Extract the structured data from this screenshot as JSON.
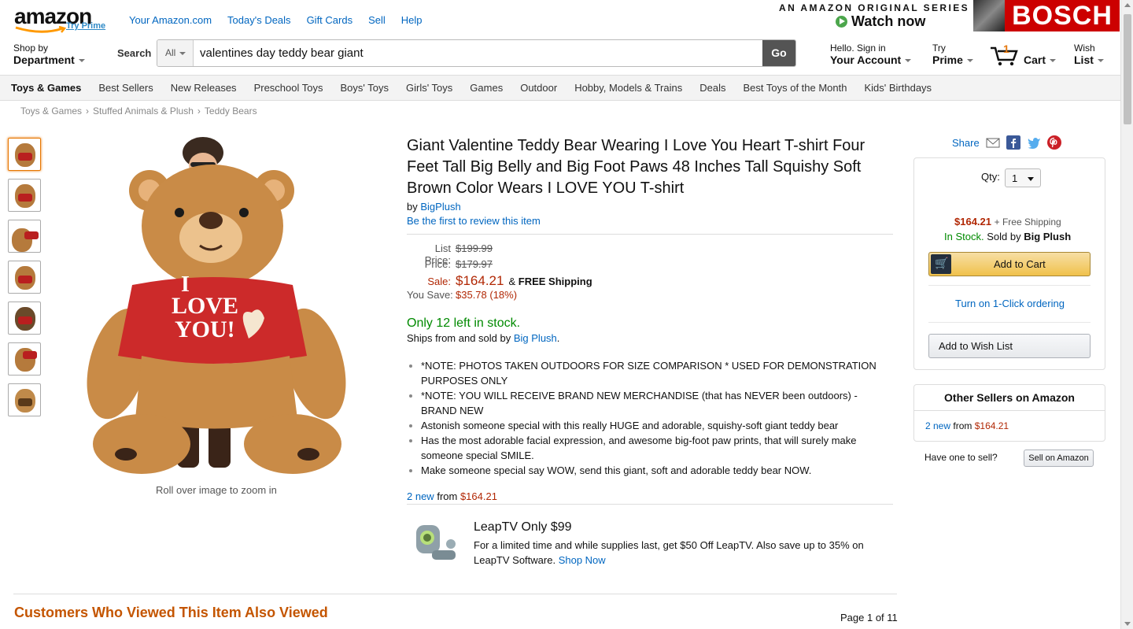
{
  "header": {
    "logo_text": "amazon",
    "try_prime": "Try Prime",
    "top_links": [
      "Your Amazon.com",
      "Today's Deals",
      "Gift Cards",
      "Sell",
      "Help"
    ],
    "promo": {
      "line1": "AN AMAZON ORIGINAL SERIES",
      "watch": "Watch now",
      "brand": "BOSCH"
    },
    "shop_by": {
      "small": "Shop by",
      "bold": "Department"
    },
    "search": {
      "label": "Search",
      "category": "All",
      "value": "valentines day teddy bear giant",
      "go": "Go"
    },
    "account": {
      "small": "Hello. Sign in",
      "bold": "Your Account"
    },
    "prime": {
      "small": "Try",
      "bold": "Prime"
    },
    "cart": {
      "count": "1",
      "label": "Cart"
    },
    "wish": {
      "small": "Wish",
      "bold": "List"
    }
  },
  "category_bar": [
    "Toys & Games",
    "Best Sellers",
    "New Releases",
    "Preschool Toys",
    "Boys' Toys",
    "Girls' Toys",
    "Games",
    "Outdoor",
    "Hobby, Models & Trains",
    "Deals",
    "Best Toys of the Month",
    "Kids' Birthdays"
  ],
  "breadcrumb": [
    "Toys & Games",
    "Stuffed Animals & Plush",
    "Teddy Bears"
  ],
  "breadcrumb_sep": "›",
  "image": {
    "roll_over": "Roll over image to zoom in",
    "shirt_text_1": "I",
    "shirt_text_2": "LOVE",
    "shirt_text_3": "YOU!"
  },
  "product": {
    "title": "Giant Valentine Teddy Bear Wearing I Love You Heart T-shirt Four Feet Tall Big Belly and Big Foot Paws 48 Inches Tall Squishy Soft Brown Color Wears I LOVE YOU T-shirt",
    "by": "by",
    "brand": "BigPlush",
    "review_link": "Be the first to review this item",
    "list_price_label": "List Price:",
    "list_price": "$199.99",
    "price_label": "Price:",
    "price": "$179.97",
    "sale_label": "Sale:",
    "sale_price": "$164.21",
    "free_ship_pre": "&",
    "free_ship": "FREE Shipping",
    "save_label": "You Save:",
    "save": "$35.78 (18%)",
    "stock": "Only 12 left in stock.",
    "ships_pre": "Ships from and sold by",
    "ships_seller": "Big Plush",
    "ships_post": ".",
    "bullets": [
      "*NOTE: PHOTOS TAKEN OUTDOORS FOR SIZE COMPARISON * USED FOR DEMONSTRATION PURPOSES ONLY",
      "*NOTE: YOU WILL RECEIVE BRAND NEW MERCHANDISE (that has NEVER been outdoors) - BRAND NEW",
      "Astonish someone special with this really HUGE and adorable, squishy-soft giant teddy bear",
      "Has the most adorable facial expression, and awesome big-foot paw prints, that will surely make someone special SMILE.",
      "Make someone special say WOW, send this giant, soft and adorable teddy bear NOW."
    ],
    "new_count": "2 new",
    "new_from": "from",
    "new_price": "$164.21"
  },
  "leap_promo": {
    "title": "LeapTV Only $99",
    "desc": "For a limited time and while supplies last, get $50 Off LeapTV. Also save up to 35% on LeapTV Software.",
    "link": "Shop Now"
  },
  "buybox": {
    "share": "Share",
    "qty_label": "Qty:",
    "qty_value": "1",
    "price": "$164.21",
    "shipping": "+ Free Shipping",
    "in_stock": "In Stock.",
    "sold_by": "Sold by",
    "seller": "Big Plush",
    "add_to_cart": "Add to Cart",
    "one_click": "Turn on 1-Click ordering",
    "wish_list": "Add to Wish List"
  },
  "other_sellers": {
    "title": "Other Sellers on Amazon",
    "count": "2 new",
    "from": "from",
    "price": "$164.21",
    "have_one": "Have one to sell?",
    "sell_button": "Sell on Amazon"
  },
  "bottom": {
    "also_viewed": "Customers Who Viewed This Item Also Viewed",
    "page": "Page 1 of 11"
  },
  "colors": {
    "link": "#0066c0",
    "price": "#b12704",
    "stock": "#008a00",
    "heading_orange": "#c45500",
    "button_yellow": "#f0c14b"
  }
}
